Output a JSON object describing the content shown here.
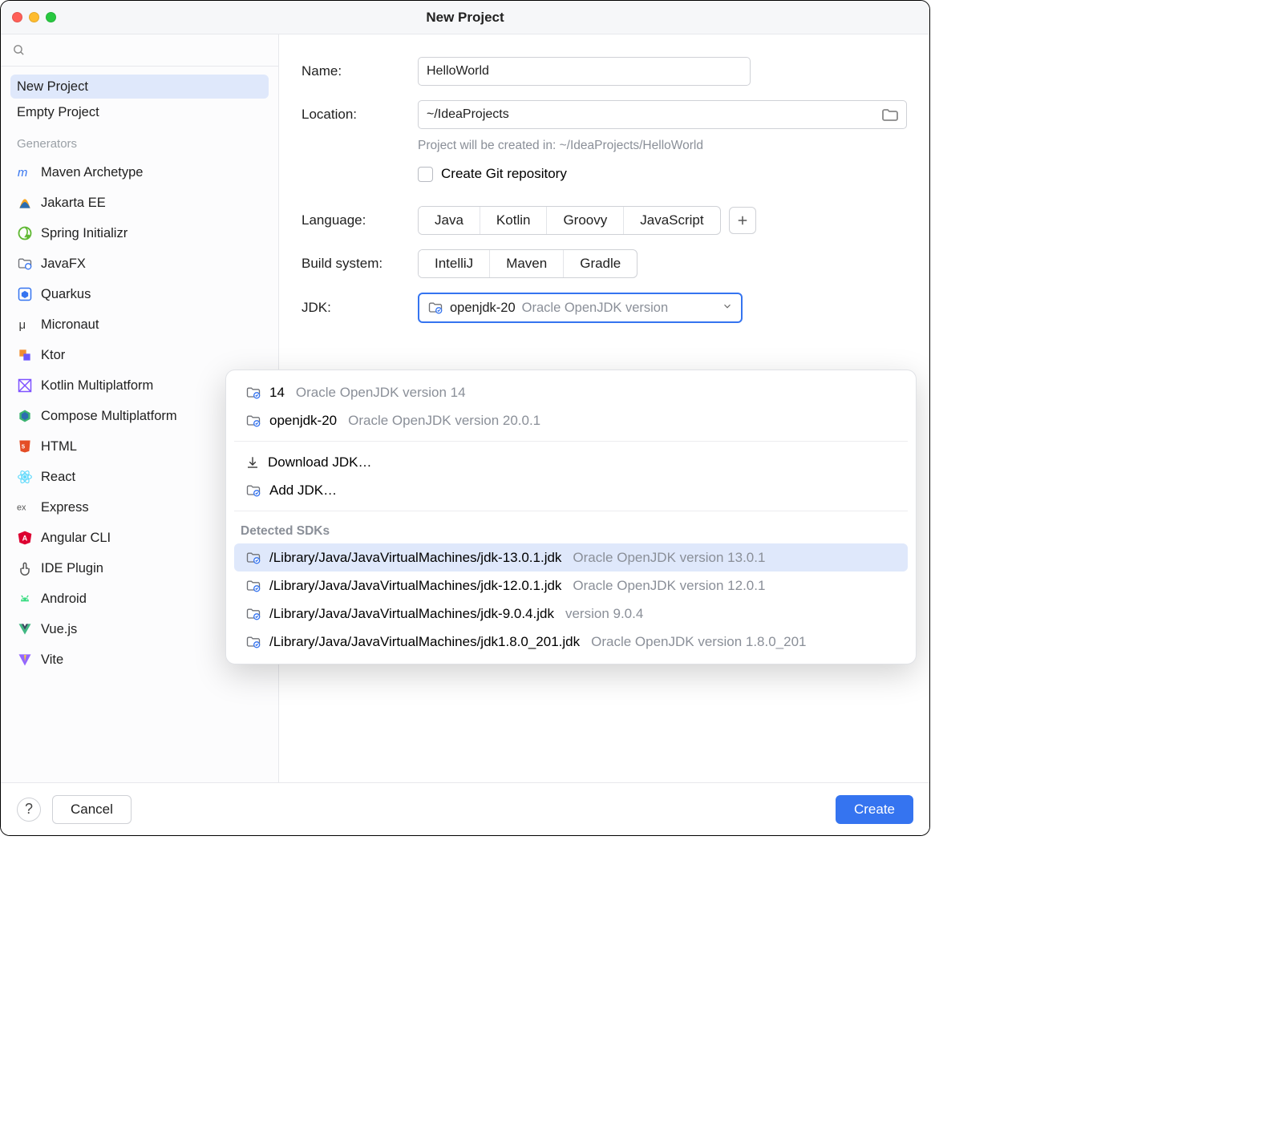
{
  "window": {
    "title": "New Project"
  },
  "sidebar": {
    "items": [
      {
        "label": "New Project",
        "selected": true
      },
      {
        "label": "Empty Project",
        "selected": false
      }
    ],
    "generators_header": "Generators",
    "generators": [
      {
        "label": "Maven Archetype",
        "icon": "maven"
      },
      {
        "label": "Jakarta EE",
        "icon": "jakarta"
      },
      {
        "label": "Spring Initializr",
        "icon": "spring"
      },
      {
        "label": "JavaFX",
        "icon": "javafx"
      },
      {
        "label": "Quarkus",
        "icon": "quarkus"
      },
      {
        "label": "Micronaut",
        "icon": "micronaut"
      },
      {
        "label": "Ktor",
        "icon": "ktor"
      },
      {
        "label": "Kotlin Multiplatform",
        "icon": "kotlin"
      },
      {
        "label": "Compose Multiplatform",
        "icon": "compose"
      },
      {
        "label": "HTML",
        "icon": "html"
      },
      {
        "label": "React",
        "icon": "react"
      },
      {
        "label": "Express",
        "icon": "express"
      },
      {
        "label": "Angular CLI",
        "icon": "angular"
      },
      {
        "label": "IDE Plugin",
        "icon": "plugin"
      },
      {
        "label": "Android",
        "icon": "android"
      },
      {
        "label": "Vue.js",
        "icon": "vue"
      },
      {
        "label": "Vite",
        "icon": "vite"
      }
    ]
  },
  "form": {
    "name_label": "Name:",
    "name_value": "HelloWorld",
    "location_label": "Location:",
    "location_value": "~/IdeaProjects",
    "location_hint": "Project will be created in: ~/IdeaProjects/HelloWorld",
    "git_checkbox_label": "Create Git repository",
    "git_checked": false,
    "language_label": "Language:",
    "languages": [
      "Java",
      "Kotlin",
      "Groovy",
      "JavaScript"
    ],
    "language_selected": "Java",
    "build_label": "Build system:",
    "builds": [
      "IntelliJ",
      "Maven",
      "Gradle"
    ],
    "build_selected": "IntelliJ",
    "jdk_label": "JDK:",
    "jdk_selected_name": "openjdk-20",
    "jdk_selected_desc": "Oracle OpenJDK version"
  },
  "dropdown": {
    "recent": [
      {
        "name": "14",
        "desc": "Oracle OpenJDK version 14"
      },
      {
        "name": "openjdk-20",
        "desc": "Oracle OpenJDK version 20.0.1"
      }
    ],
    "download_label": "Download JDK…",
    "add_label": "Add JDK…",
    "detected_header": "Detected SDKs",
    "detected": [
      {
        "path": "/Library/Java/JavaVirtualMachines/jdk-13.0.1.jdk",
        "desc": "Oracle OpenJDK version 13.0.1",
        "selected": true
      },
      {
        "path": "/Library/Java/JavaVirtualMachines/jdk-12.0.1.jdk",
        "desc": "Oracle OpenJDK version 12.0.1",
        "selected": false
      },
      {
        "path": "/Library/Java/JavaVirtualMachines/jdk-9.0.4.jdk",
        "desc": "version 9.0.4",
        "selected": false
      },
      {
        "path": "/Library/Java/JavaVirtualMachines/jdk1.8.0_201.jdk",
        "desc": "Oracle OpenJDK version 1.8.0_201",
        "selected": false
      }
    ]
  },
  "footer": {
    "cancel": "Cancel",
    "create": "Create"
  }
}
